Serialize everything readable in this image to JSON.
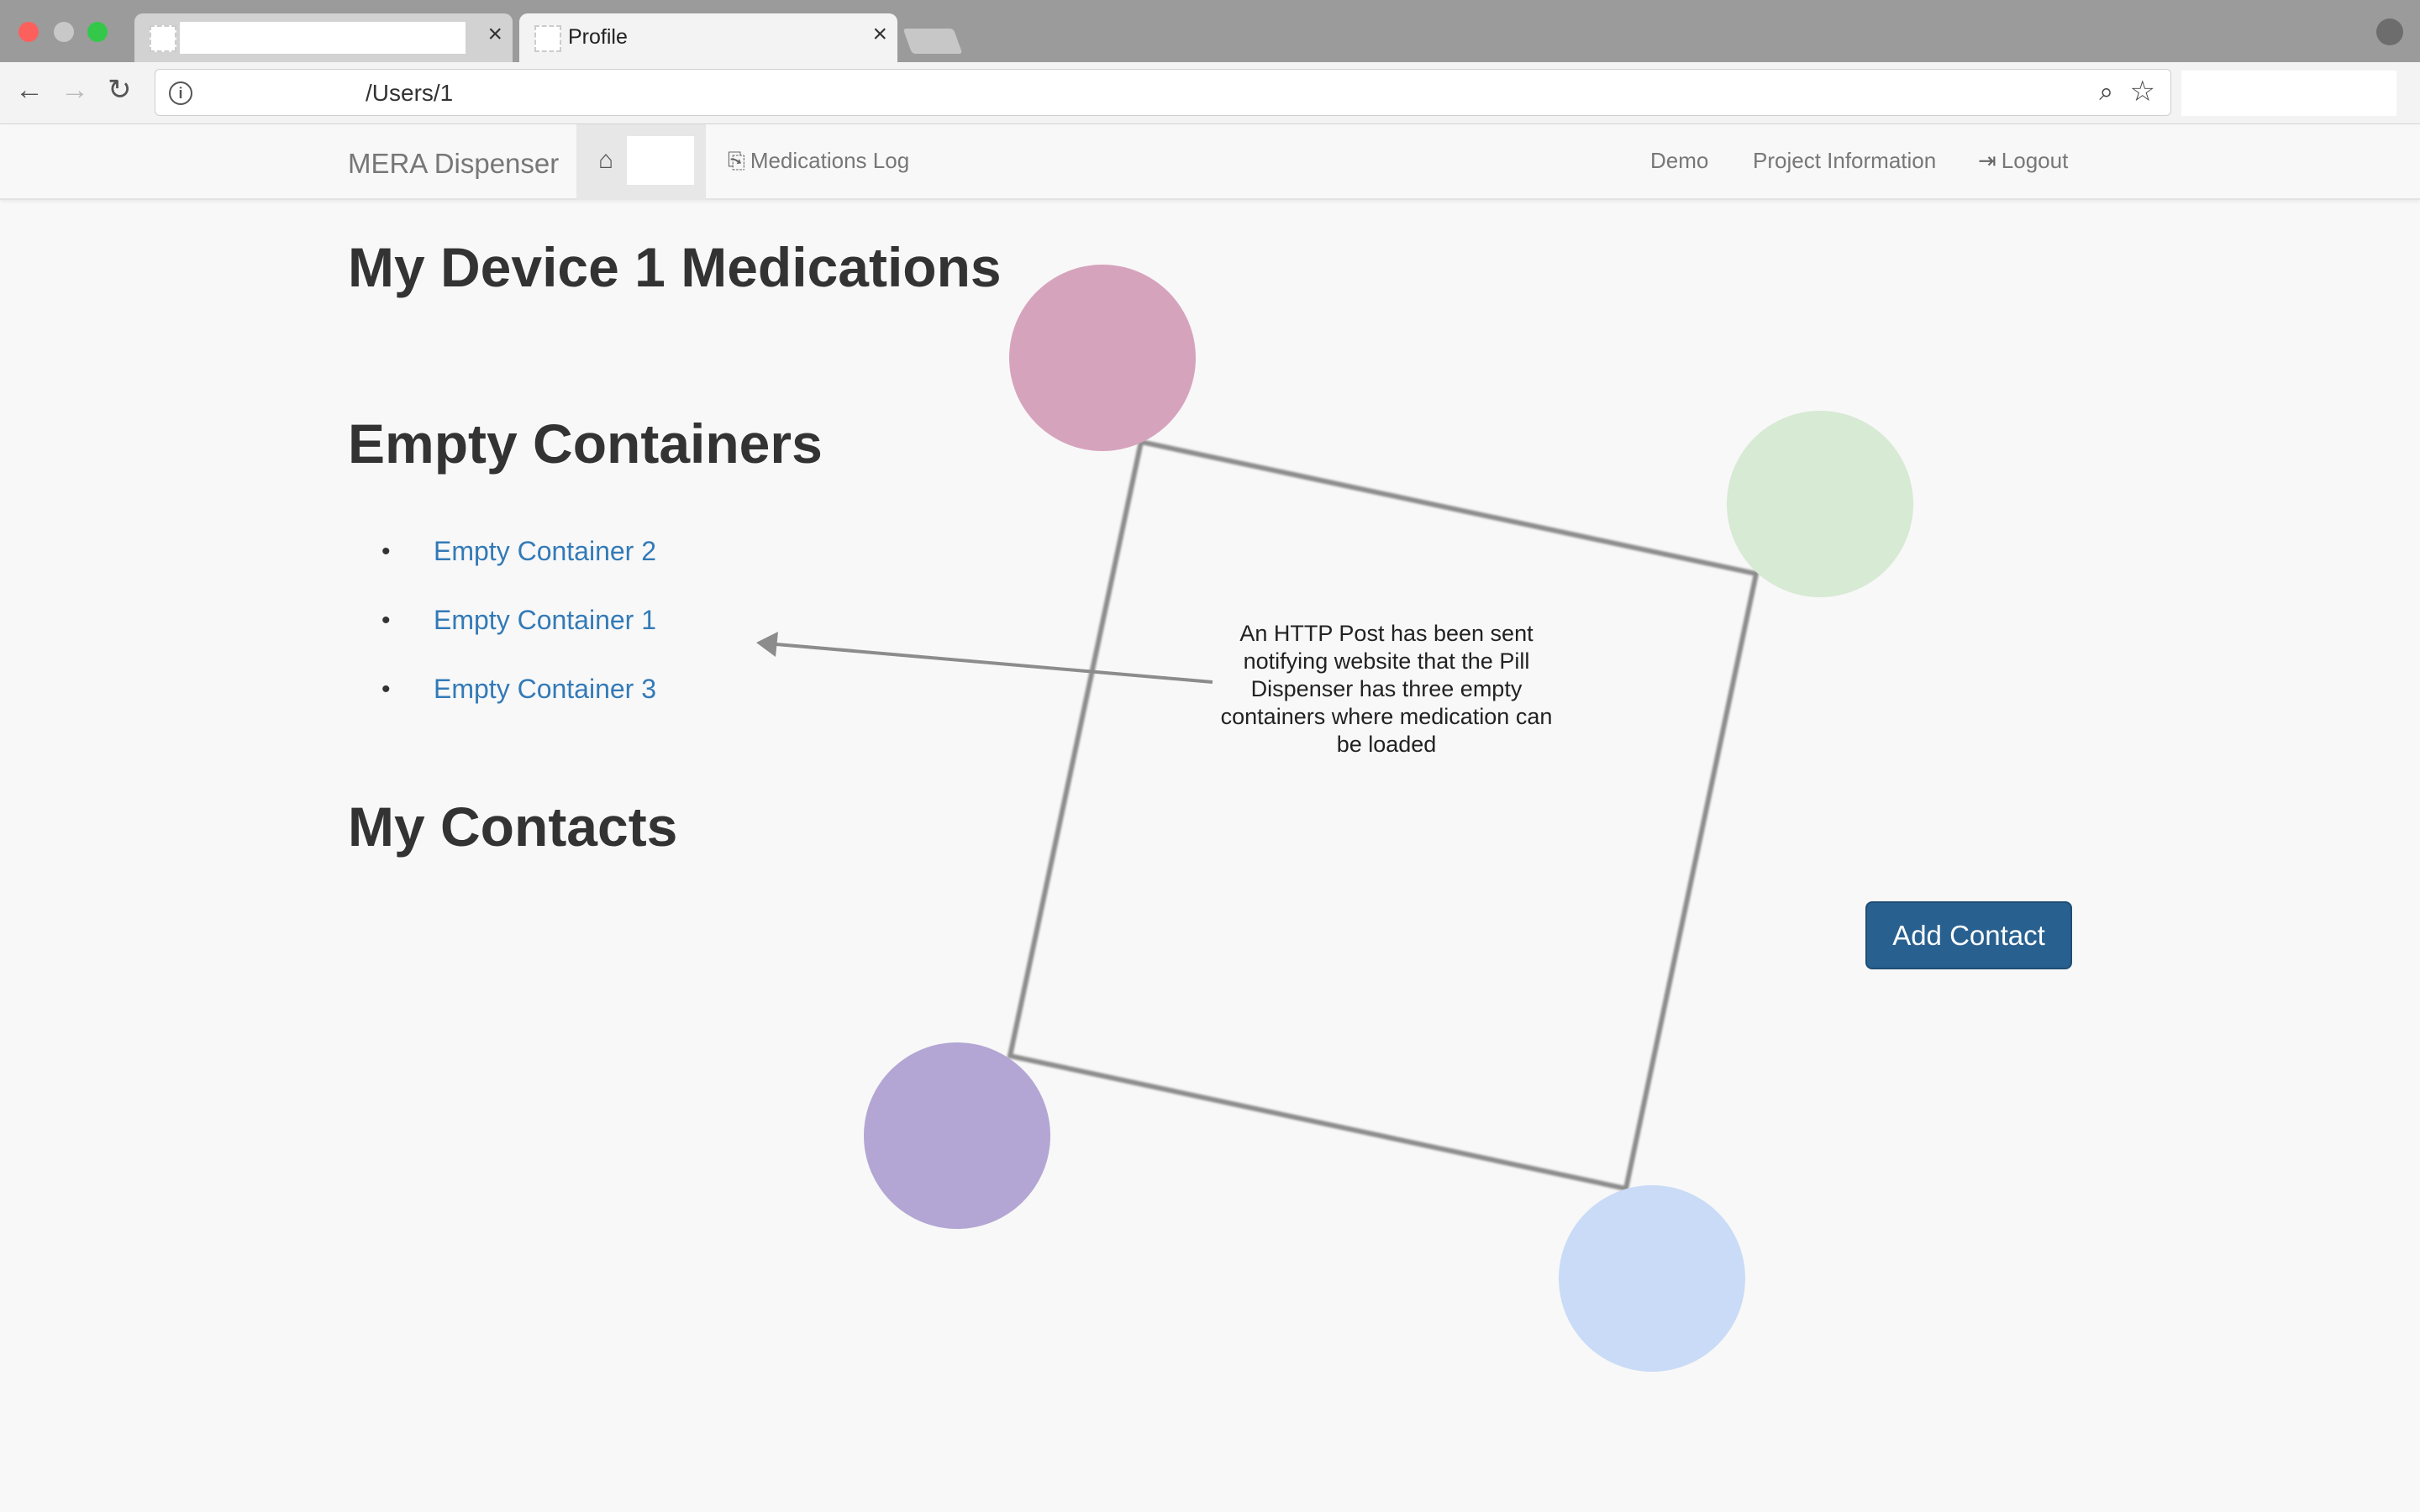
{
  "browser": {
    "tabs": [
      {
        "title": ""
      },
      {
        "title": "Profile"
      }
    ],
    "close_glyph": "×",
    "address": "/Users/1",
    "icons": {
      "back": "back-arrow-icon",
      "forward": "forward-arrow-icon",
      "reload": "reload-icon",
      "info": "info-icon",
      "zoom": "zoom-icon",
      "bookmark": "star-icon"
    }
  },
  "navbar": {
    "brand": "MERA Dispenser",
    "medications_log": "Medications Log",
    "demo": "Demo",
    "project_information": "Project Information",
    "logout": "Logout"
  },
  "page": {
    "title": "My Device 1 Medications",
    "empty_heading": "Empty Containers",
    "empty_containers": [
      "Empty Container 2",
      "Empty Container 1",
      "Empty Container 3"
    ],
    "contacts_heading": "My Contacts",
    "add_contact": "Add Contact"
  },
  "annotation": {
    "text": "An HTTP Post has been sent notifying website that the Pill Dispenser has three empty containers where medication can be loaded"
  },
  "colors": {
    "link": "#337ab7",
    "button": "#286090",
    "circle_pink": "#d6a3bd",
    "circle_green": "#d7ead3",
    "circle_purple": "#b3a6d4",
    "circle_blue": "#c9dbf6"
  }
}
